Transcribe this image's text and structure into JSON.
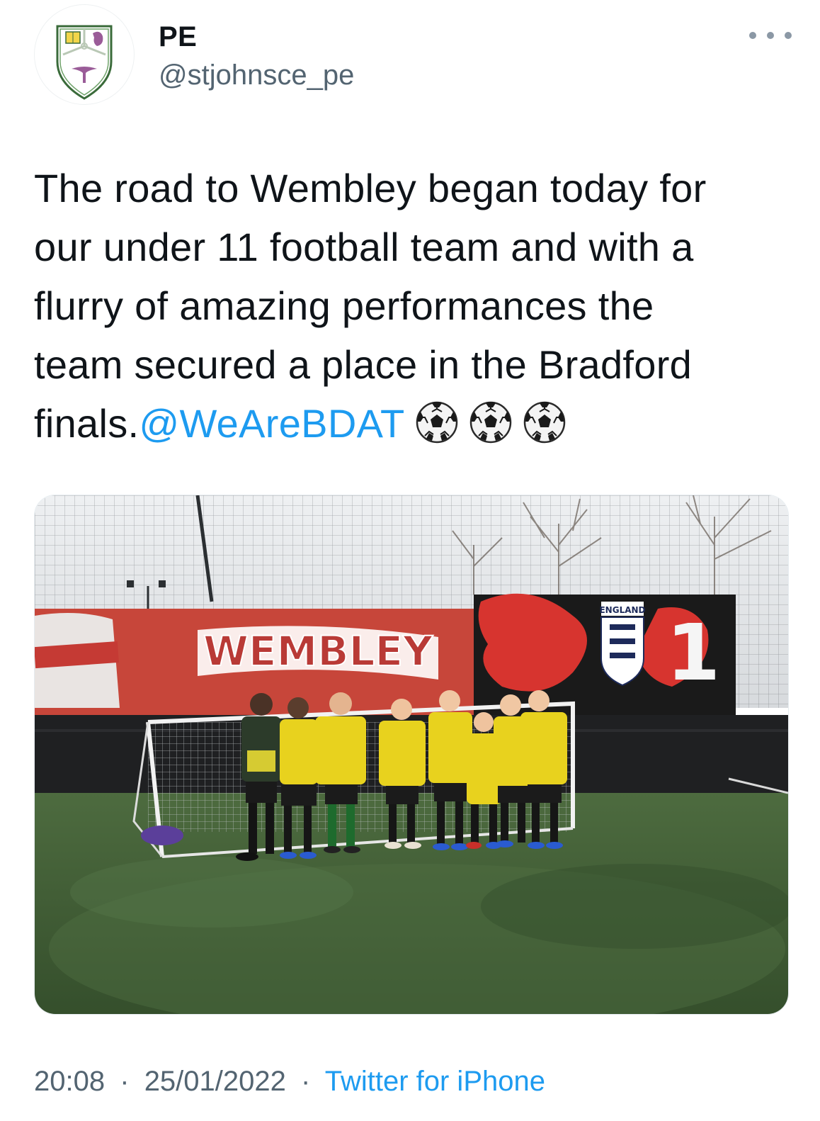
{
  "author": {
    "display_name": "PE",
    "handle": "@stjohnsce_pe",
    "avatar_icon": "school-crest-icon"
  },
  "menu": {
    "more_icon": "more-horizontal-icon"
  },
  "tweet": {
    "lines": [
      "The road to Wembley began today for",
      "our under 11 football team and with a",
      "flurry of amazing performances the",
      "team secured a place in the Bradford"
    ],
    "last_line_text": "finals.",
    "mention": "@WeAreBDAT",
    "emoji": [
      "soccer-ball-icon",
      "soccer-ball-icon",
      "soccer-ball-icon"
    ]
  },
  "media": {
    "banner_text": "WEMBLEY",
    "badge_text": "ENGLAND",
    "number_text": "1"
  },
  "footer": {
    "time": "20:08",
    "separator": "·",
    "date": "25/01/2022",
    "source": "Twitter for iPhone"
  },
  "colors": {
    "text": "#0f1419",
    "secondary": "#536471",
    "link": "#1d9bf0",
    "kit_yellow": "#e8d21e",
    "pitch_green": "#3d5f32",
    "banner_red": "#c7463a"
  }
}
